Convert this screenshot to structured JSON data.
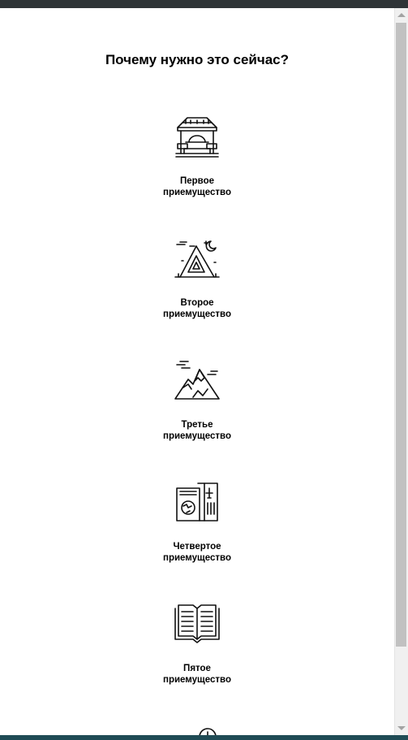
{
  "section": {
    "title": "Почему нужно это сейчас?"
  },
  "features": [
    {
      "icon": "gazebo-icon",
      "line1": "Первое",
      "line2": "приемущество"
    },
    {
      "icon": "tent-icon",
      "line1": "Второе",
      "line2": "приемущество"
    },
    {
      "icon": "mountain-icon",
      "line1": "Третье",
      "line2": "приемущество"
    },
    {
      "icon": "passport-ticket-icon",
      "line1": "Четвертое",
      "line2": "приемущество"
    },
    {
      "icon": "book-icon",
      "line1": "Пятое",
      "line2": "приемущество"
    },
    {
      "icon": "clock-icon",
      "line1": "",
      "line2": ""
    }
  ]
}
